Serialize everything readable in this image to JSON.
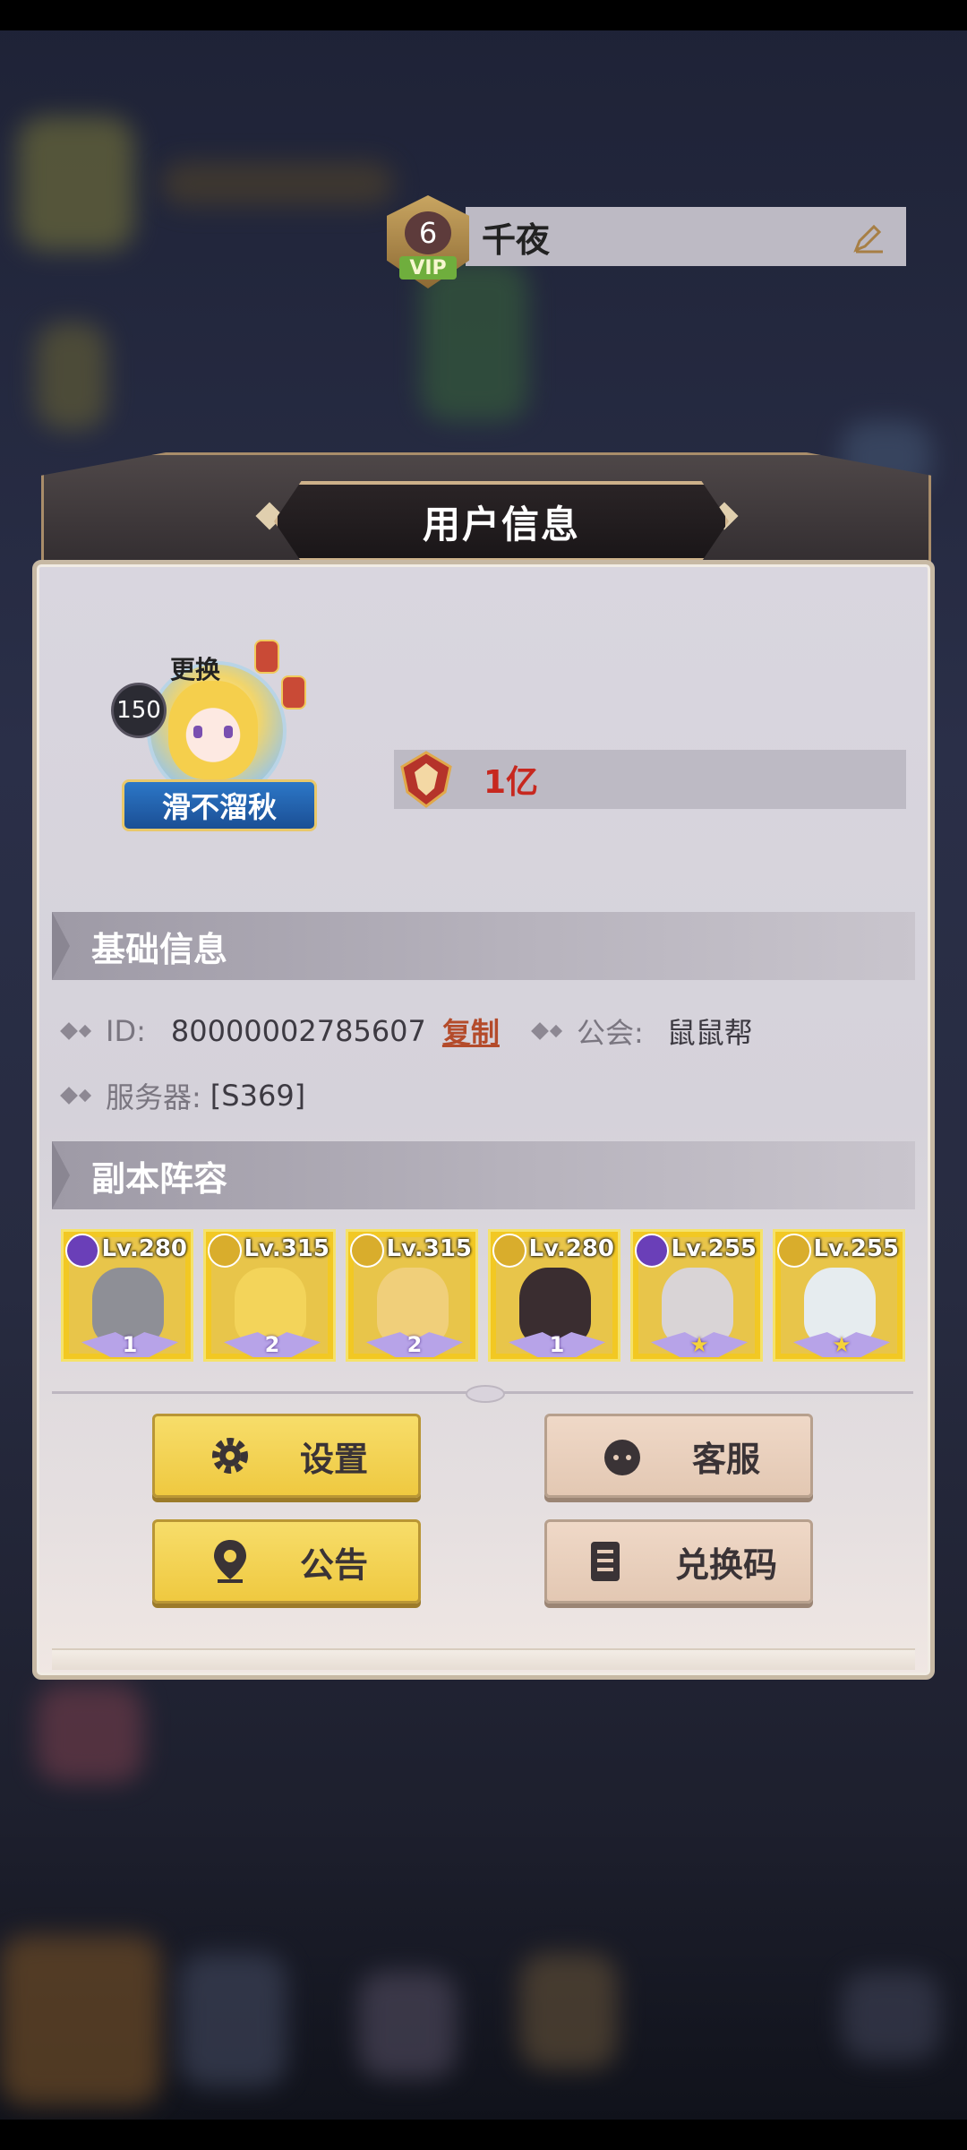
{
  "modal": {
    "title": "用户信息"
  },
  "profile": {
    "level": "150",
    "change_label": "更换",
    "nickname_plate": "滑不溜秋",
    "vip_level": "6",
    "vip_label": "VIP",
    "name": "千夜",
    "power": "1亿"
  },
  "basic_info": {
    "title": "基础信息",
    "id_label": "ID:",
    "id_value": "80000002785607",
    "copy_label": "复制",
    "guild_label": "公会:",
    "guild_value": "鼠鼠帮",
    "server_label": "服务器:",
    "server_value": "[S369]"
  },
  "lineup": {
    "title": "副本阵容",
    "heroes": [
      {
        "level": "Lv.280",
        "stars": "1",
        "element": "purple"
      },
      {
        "level": "Lv.315",
        "stars": "2",
        "element": "gold"
      },
      {
        "level": "Lv.315",
        "stars": "2",
        "element": "gold"
      },
      {
        "level": "Lv.280",
        "stars": "1",
        "element": "gold"
      },
      {
        "level": "Lv.255",
        "stars": "★",
        "element": "purple"
      },
      {
        "level": "Lv.255",
        "stars": "★",
        "element": "gold"
      }
    ]
  },
  "buttons": {
    "settings": "设置",
    "support": "客服",
    "notice": "公告",
    "redeem": "兑换码"
  },
  "colors": {
    "accent_red": "#c7281f",
    "button_gold": "#efc940",
    "button_tan": "#e3c8b3"
  }
}
